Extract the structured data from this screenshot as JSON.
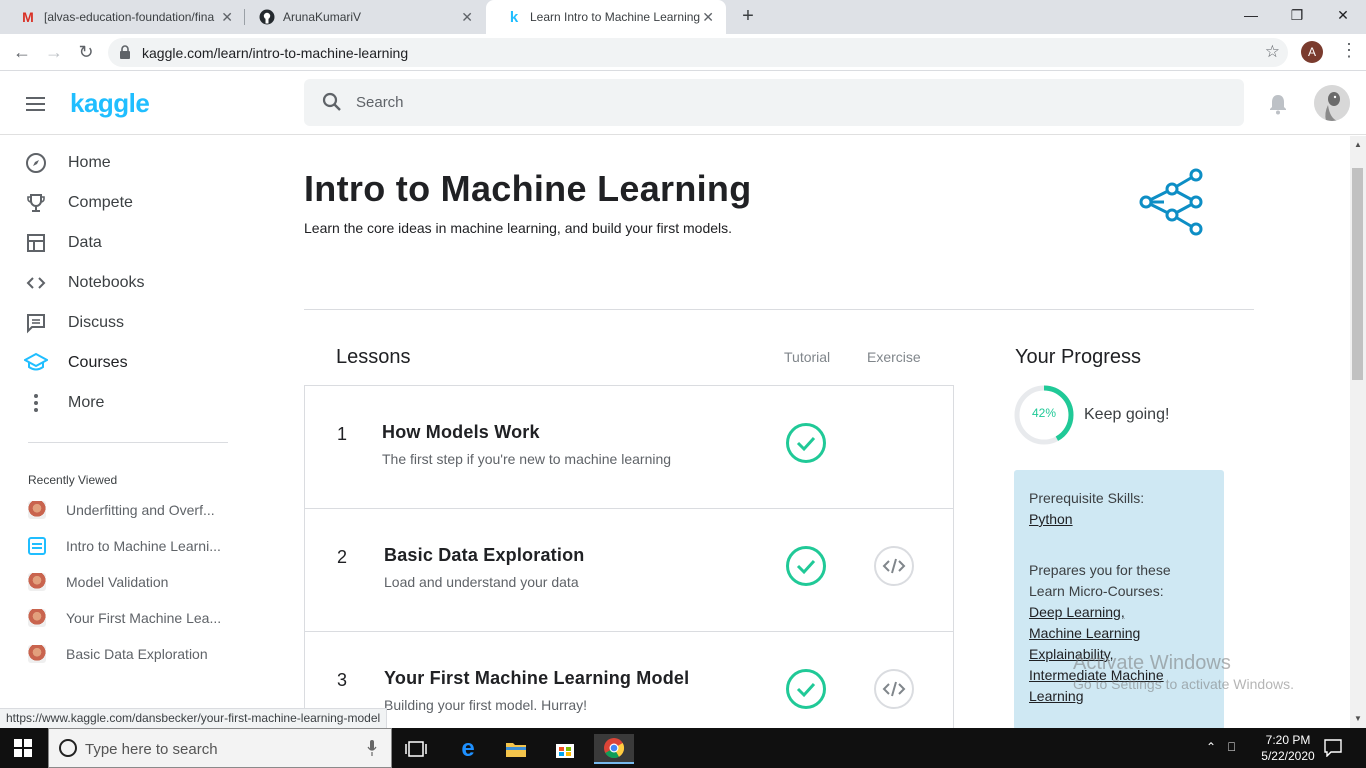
{
  "browser": {
    "tabs": [
      {
        "title": "[alvas-education-foundation/fina",
        "icon": "gmail-icon"
      },
      {
        "title": "ArunaKumariV",
        "icon": "github-icon"
      },
      {
        "title": "Learn Intro to Machine Learning",
        "icon": "kaggle-icon"
      }
    ],
    "url": "kaggle.com/learn/intro-to-machine-learning",
    "profile_initial": "A",
    "status_url": "https://www.kaggle.com/dansbecker/your-first-machine-learning-model"
  },
  "header": {
    "logo": "kaggle",
    "search_placeholder": "Search"
  },
  "sidebar": {
    "items": [
      {
        "label": "Home",
        "icon": "compass-icon"
      },
      {
        "label": "Compete",
        "icon": "trophy-icon"
      },
      {
        "label": "Data",
        "icon": "table-icon"
      },
      {
        "label": "Notebooks",
        "icon": "code-icon"
      },
      {
        "label": "Discuss",
        "icon": "comment-icon"
      },
      {
        "label": "Courses",
        "icon": "school-icon"
      },
      {
        "label": "More",
        "icon": "more-vert-icon"
      }
    ],
    "recently_viewed_title": "Recently Viewed",
    "recently_viewed": [
      "Underfitting and Overf...",
      "Intro to Machine Learni...",
      "Model Validation",
      "Your First Machine Lea...",
      "Basic Data Exploration"
    ]
  },
  "course": {
    "title": "Intro to Machine Learning",
    "subtitle": "Learn the core ideas in machine learning, and build your first models."
  },
  "lessons": {
    "heading": "Lessons",
    "col_tutorial": "Tutorial",
    "col_exercise": "Exercise",
    "items": [
      {
        "num": "1",
        "name": "How Models Work",
        "desc": "The first step if you're new to machine learning",
        "tutorial_done": true,
        "has_exercise": false
      },
      {
        "num": "2",
        "name": "Basic Data Exploration",
        "desc": "Load and understand your data",
        "tutorial_done": true,
        "has_exercise": true
      },
      {
        "num": "3",
        "name": "Your First Machine Learning Model",
        "desc": "Building your first model. Hurray!",
        "tutorial_done": true,
        "has_exercise": true
      }
    ]
  },
  "progress": {
    "heading": "Your Progress",
    "percent_label": "42%",
    "percent_value": 0.42,
    "message": "Keep going!",
    "prereq_label": "Prerequisite Skills:",
    "prereq_link": "Python",
    "prepares_label": "Prepares you for these Learn Micro-Courses:",
    "prepares_links": [
      "Deep Learning,",
      "Machine Learning Explainability,",
      "Intermediate Machine Learning"
    ]
  },
  "watermark": {
    "line1": "Activate Windows",
    "line2": "Go to Settings to activate Windows."
  },
  "taskbar": {
    "search_placeholder": "Type here to search",
    "time": "7:20 PM",
    "date": "5/22/2020"
  },
  "colors": {
    "kaggle_blue": "#20beff",
    "check_green": "#20c997",
    "prereq_bg": "#cfe8f3"
  }
}
